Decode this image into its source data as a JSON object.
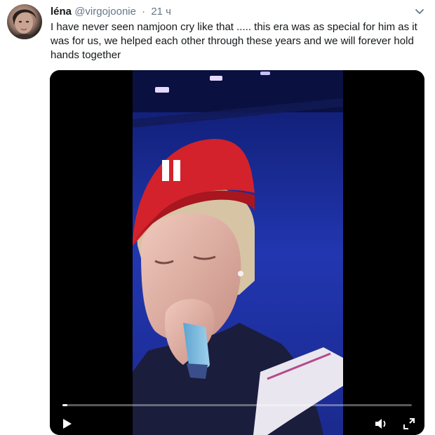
{
  "tweet": {
    "author_name": "léna",
    "handle": "@virgojoonie",
    "separator": "·",
    "time": "21 ч",
    "text": "I have never seen namjoon cry like that ..... this era was as special for him as it was for us, we helped each other through these years and we will forever hold hands together"
  },
  "icons": {
    "menu": "chevron-down-icon",
    "play": "play-icon",
    "volume": "volume-icon",
    "fullscreen": "fullscreen-icon"
  },
  "video": {
    "progress": 0.015,
    "colors": {
      "stage_blue": "#1c2f9c",
      "cap_red": "#d3222b",
      "accent": "#1da1f2"
    }
  }
}
